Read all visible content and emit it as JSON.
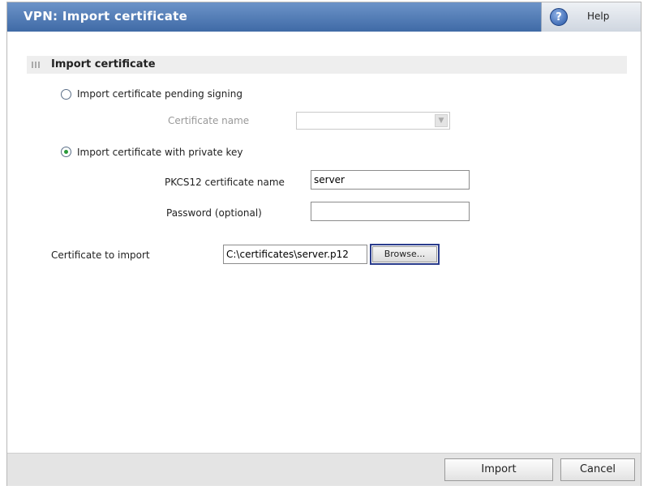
{
  "window": {
    "title": "VPN: Import certificate",
    "help_label": "Help"
  },
  "section": {
    "title": "Import certificate"
  },
  "options": {
    "pending_signing": {
      "label": "Import certificate pending signing",
      "selected": false,
      "certificate_name_label": "Certificate name",
      "certificate_name_value": ""
    },
    "private_key": {
      "label": "Import certificate with private key",
      "selected": true,
      "pkcs12_label": "PKCS12 certificate name",
      "pkcs12_value": "server",
      "password_label": "Password (optional)",
      "password_value": ""
    }
  },
  "import_file": {
    "label": "Certificate to import",
    "path": "C:\\certificates\\server.p12",
    "browse_label": "Browse..."
  },
  "footer": {
    "import_label": "Import",
    "cancel_label": "Cancel"
  },
  "colors": {
    "titlebar": "#4f79b5",
    "radio_selected": "#2a9a3a"
  }
}
